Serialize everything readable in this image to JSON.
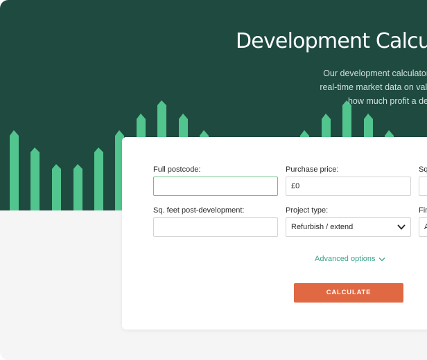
{
  "hero": {
    "title": "Development Calcula",
    "description_lines": [
      "Our development calculator combines construction cos",
      "real-time market data on values per square foot to help y",
      "how much profit a development will make."
    ]
  },
  "form": {
    "full_postcode": {
      "label": "Full postcode:",
      "value": ""
    },
    "purchase_price": {
      "label": "Purchase price:",
      "value": "£0"
    },
    "sq_feet_pre_cut": {
      "label": "Sq",
      "value": ""
    },
    "sq_feet_post": {
      "label": "Sq. feet post-development:",
      "value": ""
    },
    "project_type": {
      "label": "Project type:",
      "selected": "Refurbish / extend"
    },
    "finish_cut": {
      "label": "Fin",
      "selected": "A"
    },
    "advanced_options": "Advanced options",
    "calculate_button": "CALCULATE"
  },
  "colors": {
    "hero_bg": "#1f4a40",
    "bar_green": "#52c48e",
    "accent_teal": "#3aa48c",
    "button_orange": "#e06842",
    "focus_green": "#6cc083"
  },
  "icons": {
    "chevron": "chevron-down-icon"
  }
}
